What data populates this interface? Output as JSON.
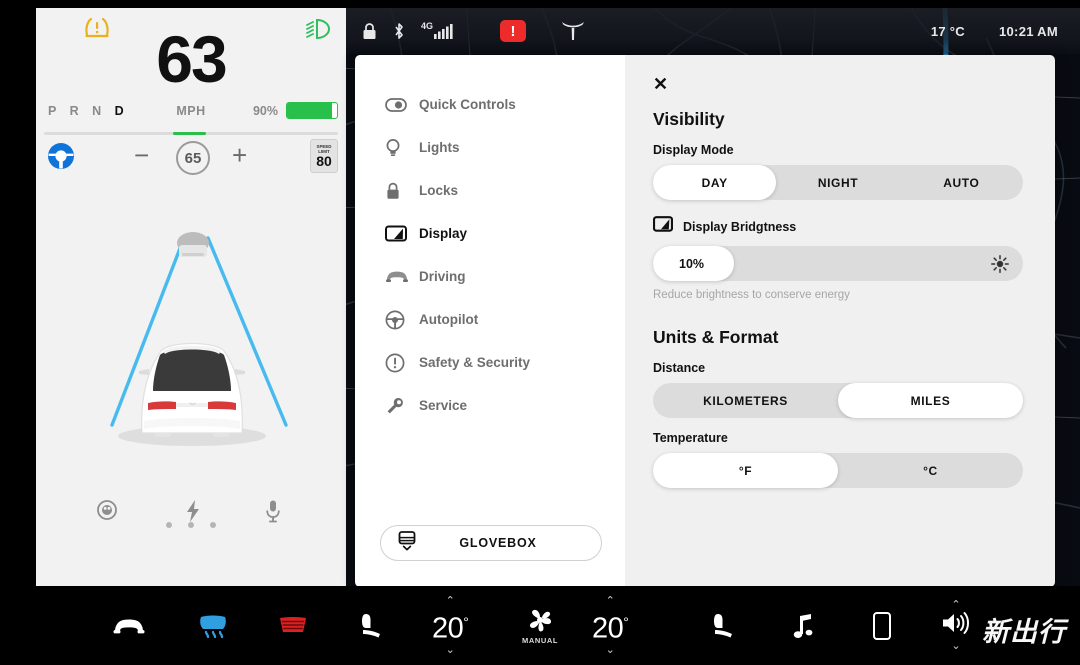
{
  "cluster": {
    "tire_pressure_icon": "tire-pressure-warning-icon",
    "tire_pressure_color": "#e8b21f",
    "headlight_icon": "low-beam-headlight-icon",
    "headlight_color": "#2fbf5e",
    "speed": "63",
    "speed_unit": "MPH",
    "gear_positions": [
      "P",
      "R",
      "N",
      "D"
    ],
    "gear_selected": "D",
    "battery_percent": "90%",
    "battery_fill_pct": 90,
    "battery_color": "#28c04a",
    "autopilot_icon": "steering-wheel-icon",
    "autopilot_color": "#0f73d9",
    "cruise_minus": "−",
    "cruise_set_speed": "65",
    "cruise_plus": "+",
    "speed_limit": {
      "caption_line1": "SPEED",
      "caption_line2": "LIMIT",
      "value": "80"
    },
    "bottom_icons": [
      {
        "name": "media-dial-icon"
      },
      {
        "name": "energy-bolt-icon"
      },
      {
        "name": "microphone-icon"
      }
    ],
    "page_dots": 3
  },
  "statusbar": {
    "icons": [
      {
        "name": "lock-icon"
      },
      {
        "name": "bluetooth-icon"
      },
      {
        "name": "cellular-signal-4g-icon",
        "label": "4G"
      }
    ],
    "alert_badge": "!",
    "alert_color": "#ee2b2b",
    "brand_icon": "tesla-logo-icon",
    "temperature": "17 °C",
    "time": "10:21 AM"
  },
  "settings": {
    "close_label": "✕",
    "menu": [
      {
        "label": "Quick Controls",
        "icon": "toggle-switch-icon",
        "active": false
      },
      {
        "label": "Lights",
        "icon": "lightbulb-icon",
        "active": false
      },
      {
        "label": "Locks",
        "icon": "padlock-icon",
        "active": false
      },
      {
        "label": "Display",
        "icon": "display-screen-icon",
        "active": true
      },
      {
        "label": "Driving",
        "icon": "car-front-icon",
        "active": false
      },
      {
        "label": "Autopilot",
        "icon": "steering-wheel-icon",
        "active": false
      },
      {
        "label": "Safety & Security",
        "icon": "alert-circle-icon",
        "active": false
      },
      {
        "label": "Service",
        "icon": "wrench-icon",
        "active": false
      }
    ],
    "glovebox": {
      "label": "GLOVEBOX",
      "icon": "glovebox-drawer-icon"
    },
    "visibility": {
      "title": "Visibility",
      "display_mode_label": "Display Mode",
      "display_mode_options": [
        "DAY",
        "NIGHT",
        "AUTO"
      ],
      "display_mode_selected": "DAY",
      "brightness_label": "Display Bridgtness",
      "brightness_checkbox": "checkbox-checked-icon",
      "brightness_value": "10%",
      "brightness_pct": 22,
      "brightness_sun_icon": "sun-brightness-icon",
      "brightness_hint": "Reduce brightness to conserve energy"
    },
    "units": {
      "title": "Units & Format",
      "distance_label": "Distance",
      "distance_options": [
        "KILOMETERS",
        "MILES"
      ],
      "distance_selected": "MILES",
      "temperature_label": "Temperature",
      "temperature_options": [
        "°F",
        "°C"
      ],
      "temperature_selected": "°F"
    }
  },
  "bottombar": {
    "items": [
      {
        "name": "car-controls-icon",
        "color": "#ffffff"
      },
      {
        "name": "front-defrost-icon",
        "color": "#2f9fe0"
      },
      {
        "name": "rear-defrost-icon",
        "color": "#e02020"
      },
      {
        "name": "driver-seat-heater-icon",
        "color": "#ffffff"
      }
    ],
    "driver_temp": "20",
    "driver_temp_degree": "°",
    "fan_label": "MANUAL",
    "fan_icon": "fan-icon",
    "passenger_temp": "20",
    "passenger_temp_degree": "°",
    "right_items": [
      {
        "name": "passenger-seat-heater-icon",
        "color": "#ffffff"
      },
      {
        "name": "media-music-icon",
        "color": "#ffffff"
      },
      {
        "name": "phone-device-icon",
        "color": "#ffffff"
      }
    ],
    "volume_icon": "volume-speaker-icon",
    "chevron_up": "⌃",
    "chevron_down": "⌄"
  },
  "watermark": {
    "text": "新出行"
  }
}
